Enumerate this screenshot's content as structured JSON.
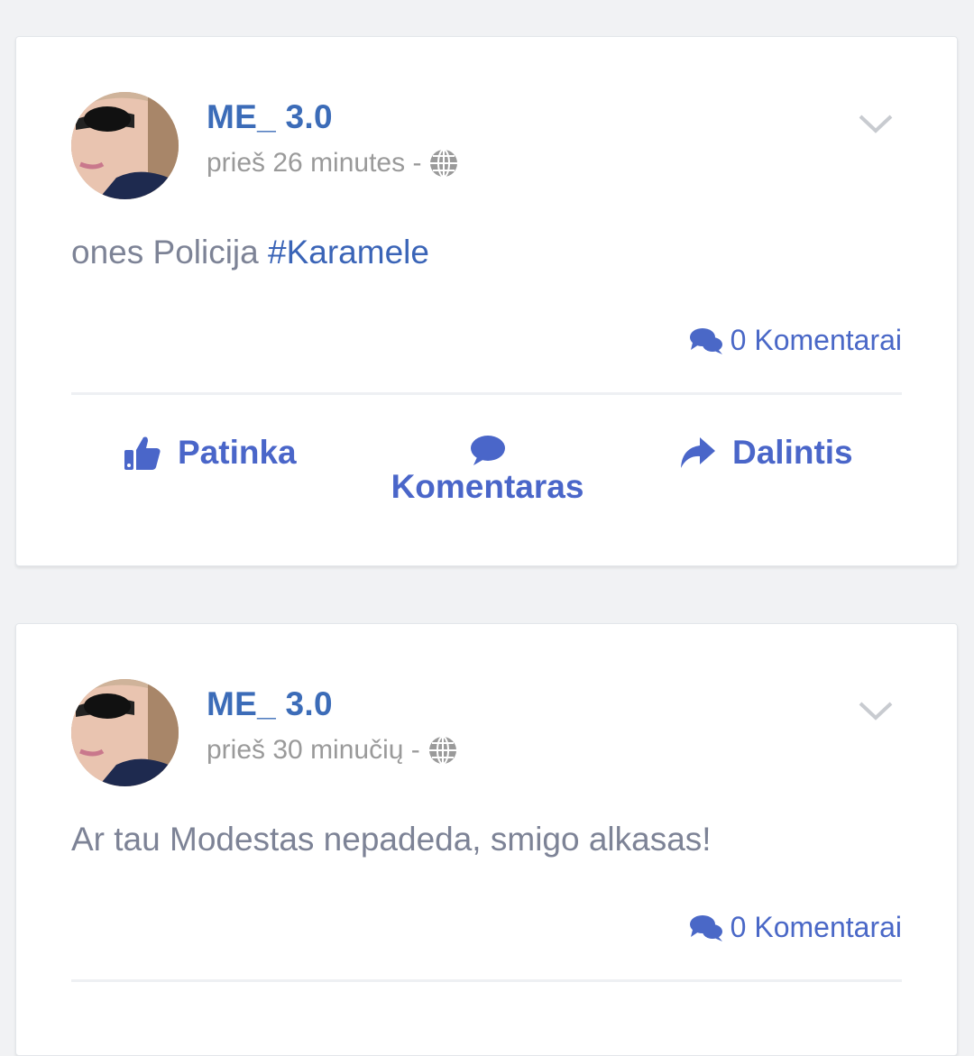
{
  "posts": [
    {
      "author": "ME_ 3.0",
      "time": "prieš 26 minutes -",
      "text": "ones Policija ",
      "hashtag": "#Karamele",
      "comments_count": "0 Komentarai",
      "actions": {
        "like": "Patinka",
        "comment": "Komentaras",
        "share": "Dalintis"
      }
    },
    {
      "author": "ME_ 3.0",
      "time": "prieš 30 minučių -",
      "text": "Ar tau Modestas nepadeda, smigo alkasas!",
      "hashtag": "",
      "comments_count": "0 Komentarai"
    }
  ],
  "colors": {
    "accent": "#4a66c9",
    "author": "#3c6cb8",
    "muted_text": "#9a9a9a",
    "post_text": "#7d8396",
    "background": "#f1f2f4"
  },
  "icons": {
    "avatar": "profile-photo",
    "visibility": "globe-icon",
    "menu": "chevron-down-icon",
    "comments": "comments-icon",
    "like": "thumbs-up-icon",
    "comment": "comment-bubble-icon",
    "share": "share-arrow-icon"
  }
}
